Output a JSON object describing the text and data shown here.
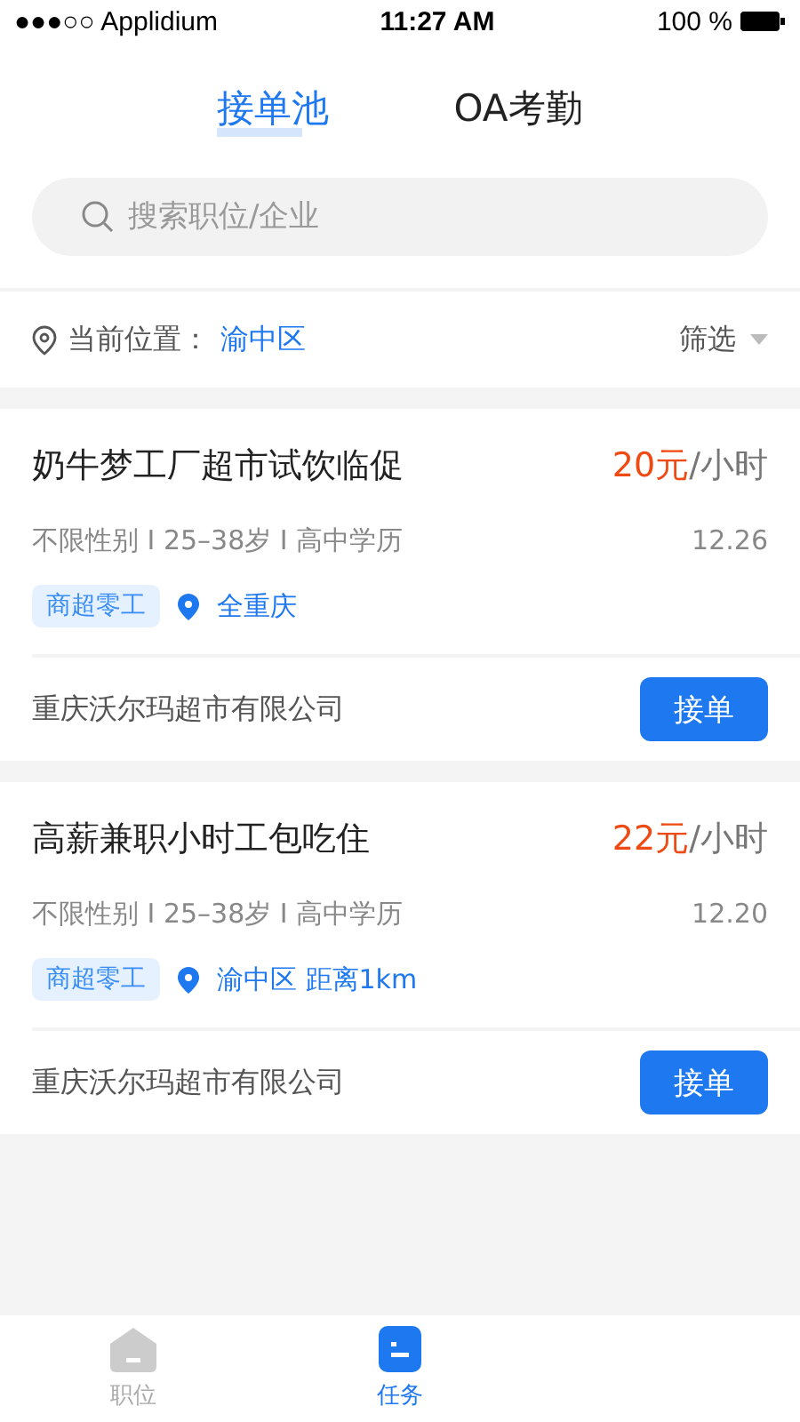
{
  "status_bar": {
    "carrier": "●●●○○ Applidium",
    "time": "11:27 AM",
    "battery": "100 %"
  },
  "tabs": [
    {
      "label": "接单池",
      "selected": true
    },
    {
      "label": "OA考勤",
      "selected": false
    }
  ],
  "search": {
    "placeholder": "搜索职位/企业"
  },
  "location": {
    "label": "当前位置：",
    "value": "渝中区",
    "filter": "筛选"
  },
  "jobs": [
    {
      "title": "奶牛梦工厂超市试饮临促",
      "price": "20元",
      "unit": "/小时",
      "requirements": "不限性别 I 25–38岁 I 高中学历",
      "date": "12.26",
      "tag": "商超零工",
      "place": "全重庆",
      "company": "重庆沃尔玛超市有限公司",
      "action": "接单"
    },
    {
      "title": "高薪兼职小时工包吃住",
      "price": "22元",
      "unit": "/小时",
      "requirements": "不限性别 I 25–38岁 I 高中学历",
      "date": "12.20",
      "tag": "商超零工",
      "place": "渝中区 距离1km",
      "company": "重庆沃尔玛超市有限公司",
      "action": "接单"
    }
  ],
  "bottom_nav": [
    {
      "label": "职位",
      "selected": false
    },
    {
      "label": "任务",
      "selected": true
    }
  ]
}
